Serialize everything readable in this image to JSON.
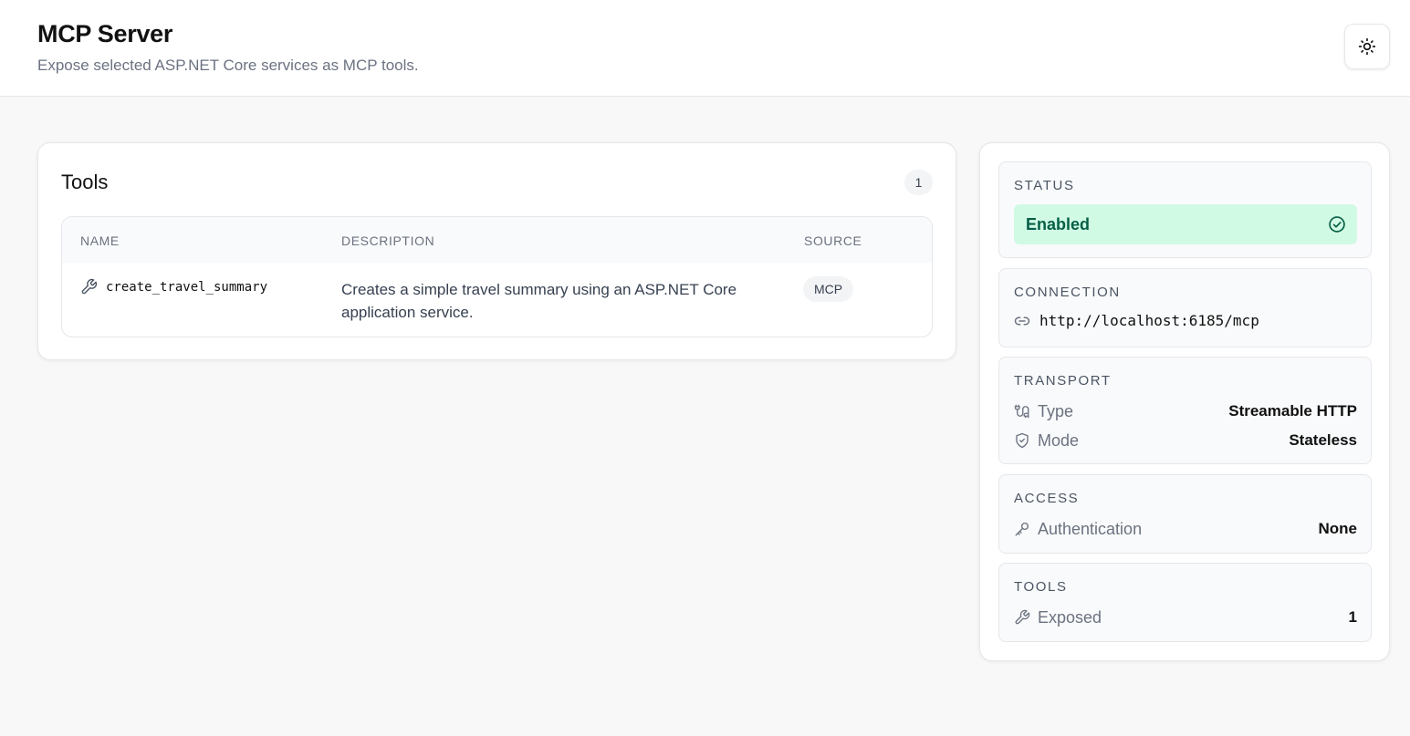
{
  "header": {
    "title": "MCP Server",
    "subtitle": "Expose selected ASP.NET Core services as MCP tools.",
    "theme_toggle_icon": "sun-icon"
  },
  "tools": {
    "title": "Tools",
    "count": "1",
    "columns": [
      "NAME",
      "DESCRIPTION",
      "SOURCE"
    ],
    "rows": [
      {
        "icon": "wrench-icon",
        "name": "create_travel_summary",
        "description": "Creates a simple travel summary using an ASP.NET Core application service.",
        "source": "MCP"
      }
    ]
  },
  "sidebar": {
    "status": {
      "label": "STATUS",
      "value": "Enabled",
      "icon": "check-circle-icon",
      "bg_color": "#d1fae5",
      "text_color": "#065f46"
    },
    "connection": {
      "label": "CONNECTION",
      "icon": "link-icon",
      "url": "http://localhost:6185/mcp"
    },
    "transport": {
      "label": "TRANSPORT",
      "type_label": "Type",
      "type_value": "Streamable HTTP",
      "type_icon": "cable-icon",
      "mode_label": "Mode",
      "mode_value": "Stateless",
      "mode_icon": "shield-check-icon"
    },
    "access": {
      "label": "ACCESS",
      "auth_label": "Authentication",
      "auth_value": "None",
      "auth_icon": "key-icon"
    },
    "tools": {
      "label": "TOOLS",
      "exposed_label": "Exposed",
      "exposed_value": "1",
      "exposed_icon": "wrench-icon"
    }
  }
}
